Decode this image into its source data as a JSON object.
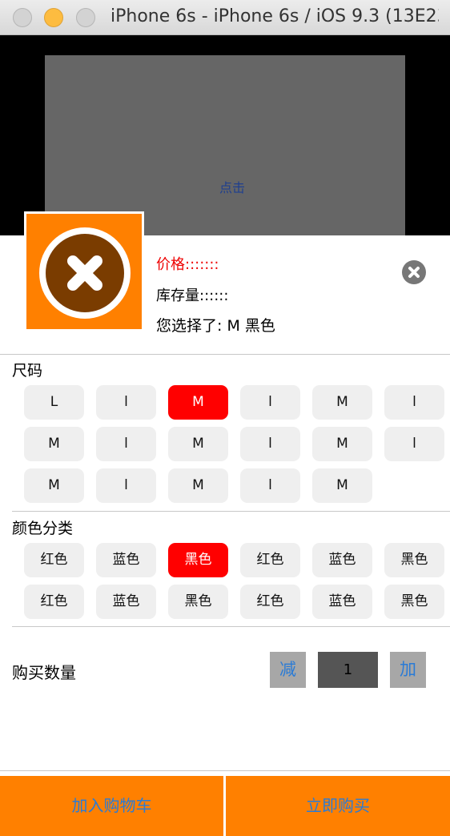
{
  "window": {
    "title": "iPhone 6s - iPhone 6s / iOS 9.3 (13E230)"
  },
  "overlay": {
    "tap_label": "点击"
  },
  "product": {
    "price_label": "价格:::::::",
    "stock_label": "库存量::::::",
    "selected_text": "您选择了: M  黑色"
  },
  "size": {
    "title": "尺码",
    "options": [
      "L",
      "l",
      "M",
      "l",
      "M",
      "l",
      "M",
      "l",
      "M",
      "l",
      "M",
      "l",
      "M",
      "l",
      "M",
      "l",
      "M"
    ],
    "selected_index": 2
  },
  "color": {
    "title": "颜色分类",
    "options": [
      "红色",
      "蓝色",
      "黑色",
      "红色",
      "蓝色",
      "黑色",
      "红色",
      "蓝色",
      "黑色",
      "红色",
      "蓝色",
      "黑色"
    ],
    "selected_index": 2
  },
  "quantity": {
    "label": "购买数量",
    "decrement": "减",
    "value": "1",
    "increment": "加"
  },
  "actions": {
    "add_to_cart": "加入购物车",
    "buy_now": "立即购买"
  },
  "colors": {
    "accent": "#ff8000",
    "selected": "#ff0000",
    "link": "#2a7bd6"
  }
}
